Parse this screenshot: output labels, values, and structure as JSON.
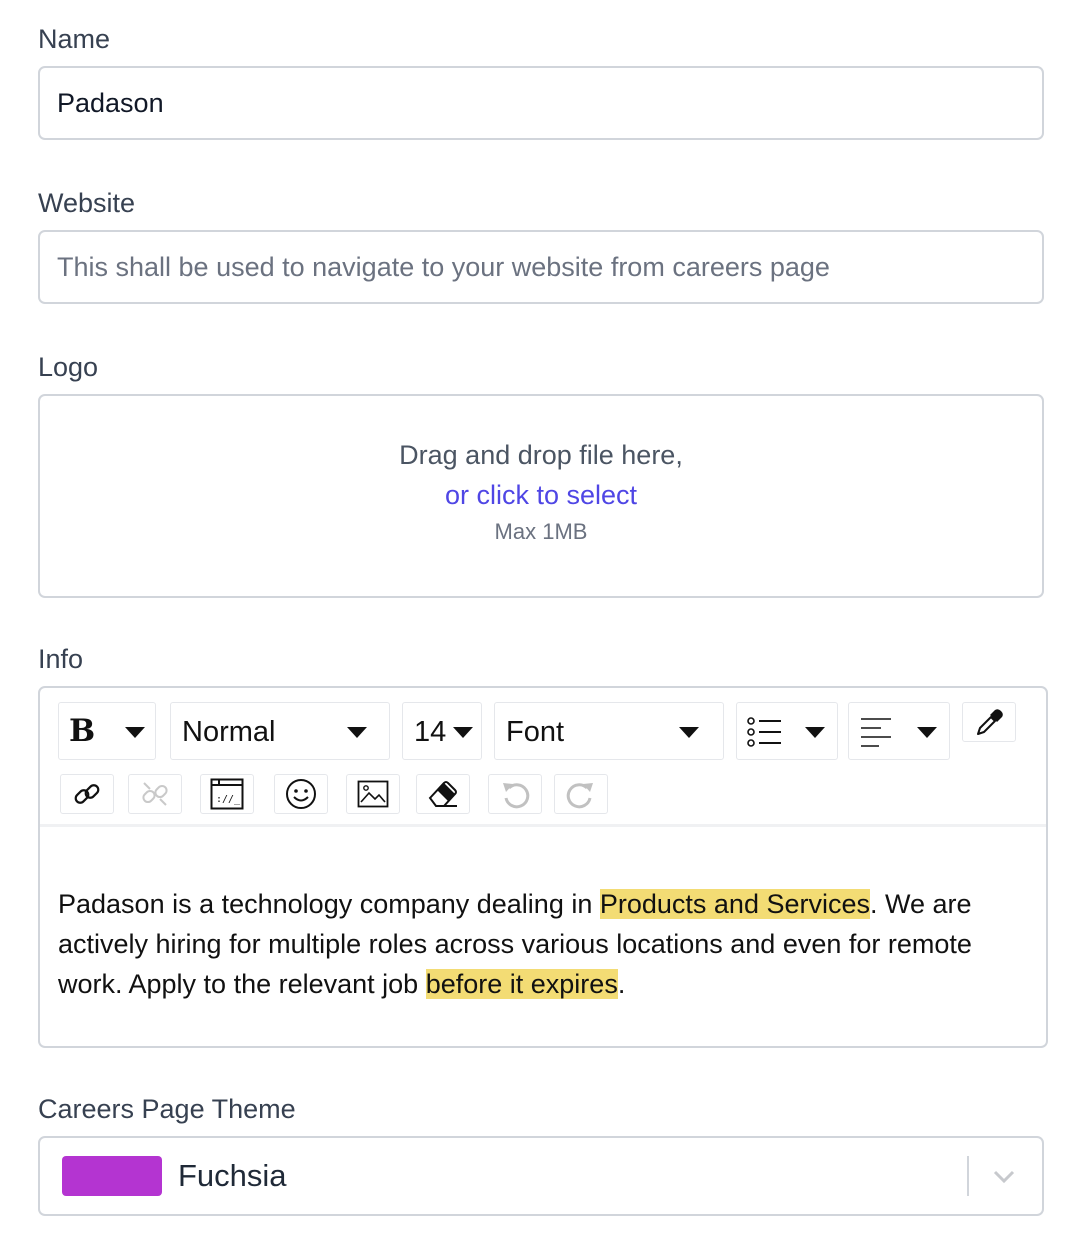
{
  "name": {
    "label": "Name",
    "value": "Padason"
  },
  "website": {
    "label": "Website",
    "placeholder": "This shall be used to navigate to your website from careers page"
  },
  "logo": {
    "label": "Logo",
    "drop_text": "Drag and drop file here,",
    "select_link": "or click to select",
    "max_size": "Max 1MB"
  },
  "info": {
    "label": "Info",
    "toolbar": {
      "bold": "B",
      "block_format": "Normal",
      "font_size": "14",
      "font_family": "Font",
      "icons": [
        "bold-icon",
        "list-icon",
        "align-left-icon",
        "eyedropper-icon",
        "link-icon",
        "unlink-icon",
        "embed-icon",
        "emoji-icon",
        "image-icon",
        "eraser-icon",
        "undo-icon",
        "redo-icon"
      ]
    },
    "content": {
      "part1": "Padason is a technology company dealing in ",
      "highlight1": "Products and Services",
      "part2": ". We are actively hiring for multiple roles across various locations and even for remote work. Apply to the relevant job ",
      "highlight2": "before it expires",
      "part3": "."
    },
    "highlight_color": "#f3dc74"
  },
  "theme": {
    "label": "Careers Page Theme",
    "selected": "Fuchsia",
    "swatch_color": "#b434d1"
  }
}
